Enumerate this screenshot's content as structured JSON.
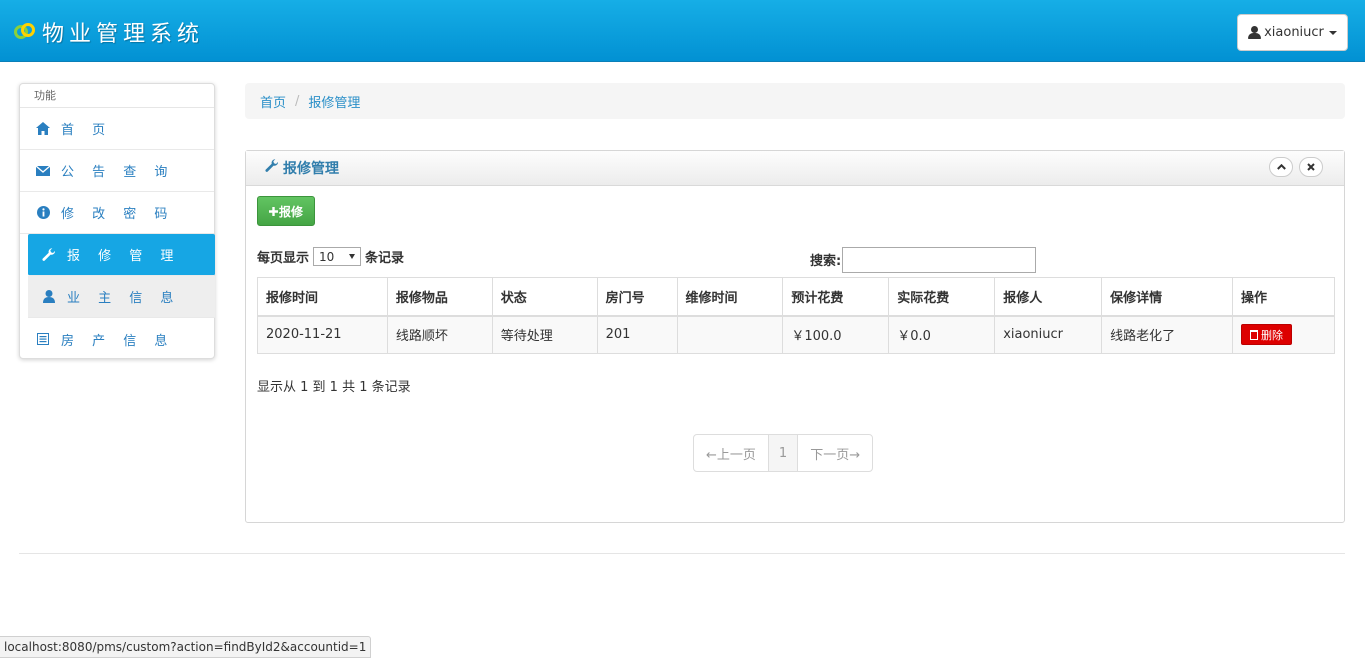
{
  "app": {
    "title": "物业管理系统",
    "user": "xiaoniucr"
  },
  "sidebar": {
    "heading": "功能",
    "items": [
      {
        "label": "首 页",
        "icon": "home-icon"
      },
      {
        "label": "公 告 查 询",
        "icon": "envelope-icon"
      },
      {
        "label": "修 改 密 码",
        "icon": "info-icon"
      },
      {
        "label": "报 修 管 理",
        "icon": "wrench-icon"
      },
      {
        "label": "业 主 信 息",
        "icon": "user-icon"
      },
      {
        "label": "房 产 信 息",
        "icon": "list-icon"
      }
    ]
  },
  "breadcrumb": {
    "home": "首页",
    "sep": "/",
    "current": "报修管理"
  },
  "panel": {
    "title": "报修管理",
    "add_label": "报修",
    "length": {
      "prefix": "每页显示",
      "value": "10",
      "suffix": "条记录"
    },
    "search_label": "搜索:",
    "columns": [
      "报修时间",
      "报修物品",
      "状态",
      "房门号",
      "维修时间",
      "预计花费",
      "实际花费",
      "报修人",
      "保修详情",
      "操作"
    ],
    "rows": [
      {
        "time": "2020-11-21",
        "item": "线路顺坏",
        "status": "等待处理",
        "room": "201",
        "repair_time": "",
        "est_cost": "￥100.0",
        "actual_cost": "￥0.0",
        "reporter": "xiaoniucr",
        "detail": "线路老化了",
        "action": "删除"
      }
    ],
    "info": "显示从 1 到 1 共 1 条记录",
    "pager": {
      "prev": "←上一页",
      "current": "1",
      "next": "下一页→"
    }
  },
  "status_url": "localhost:8080/pms/custom?action=findById2&accountid=1"
}
